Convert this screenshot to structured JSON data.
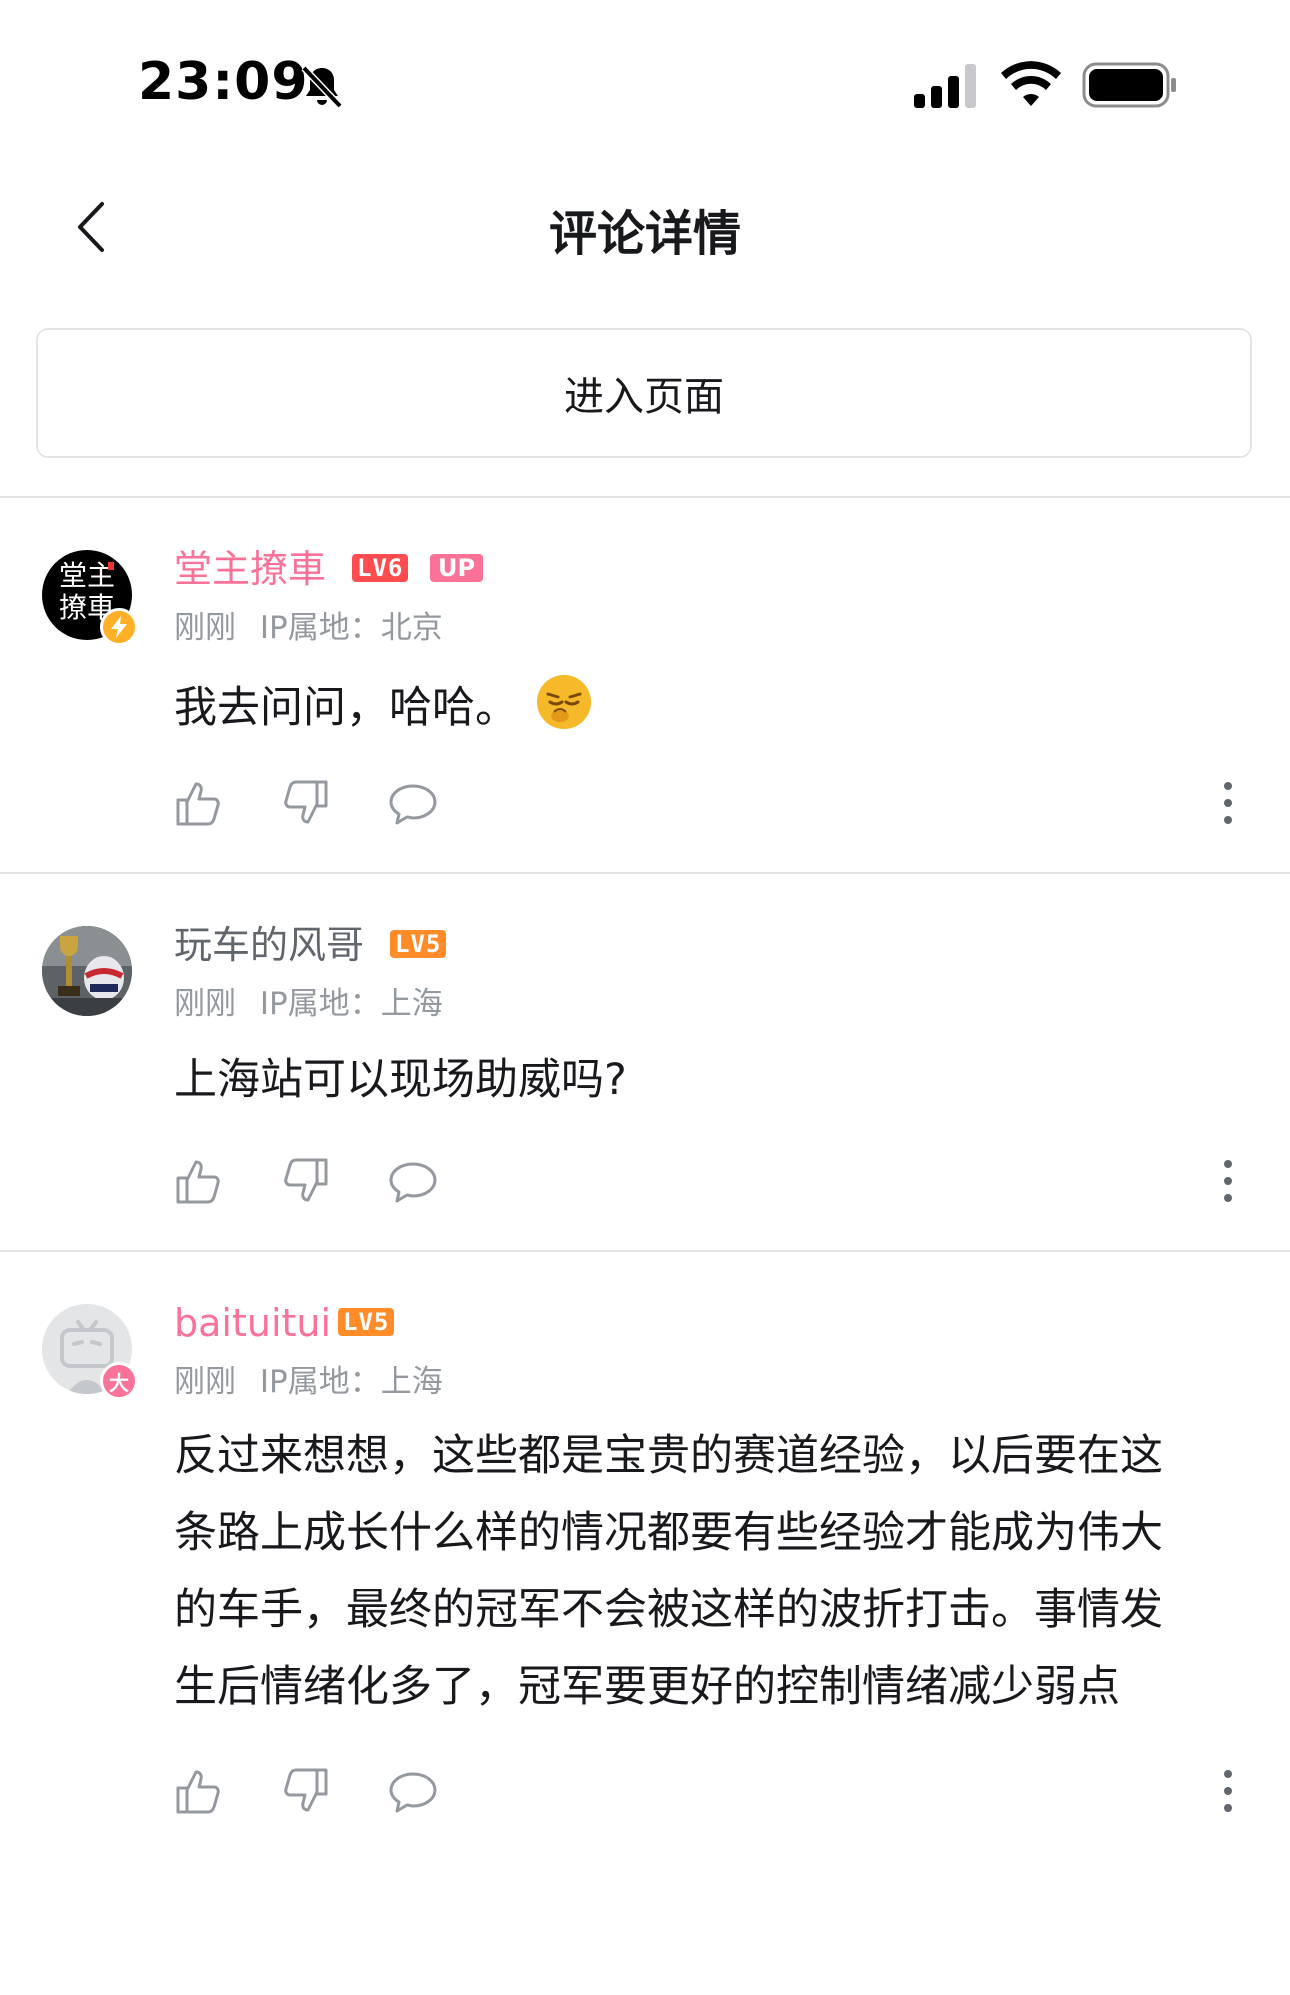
{
  "status_bar": {
    "time": "23:09"
  },
  "nav": {
    "title": "评论详情"
  },
  "enter_button": {
    "label": "进入页面"
  },
  "comments": [
    {
      "username": "堂主撩車",
      "level": "LV6",
      "up_badge": "UP",
      "time": "刚刚",
      "ip": "IP属地：北京",
      "text": "我去问问，哈哈。",
      "avatar_text": "堂主撩車"
    },
    {
      "username": "玩车的风哥",
      "level": "LV5",
      "time": "刚刚",
      "ip": "IP属地：上海",
      "text": "上海站可以现场助威吗?"
    },
    {
      "username": "baituitui",
      "level": "LV5",
      "time": "刚刚",
      "ip": "IP属地：上海",
      "lines": [
        "反过来想想，这些都是宝贵的赛道经验，以后要在这",
        "条路上成长什么样的情况都要有些经验才能成为伟大",
        "的车手，最终的冠军不会被这样的波折打击。事情发",
        "生后情绪化多了，冠军要更好的控制情绪减少弱点"
      ],
      "avatar_badge": "大"
    }
  ],
  "colors": {
    "pink": "#fb7299",
    "lv6": "#ff4d4f",
    "lv5": "#ff8c29",
    "gray_text": "#9499a0",
    "divider": "#e3e5e7"
  }
}
